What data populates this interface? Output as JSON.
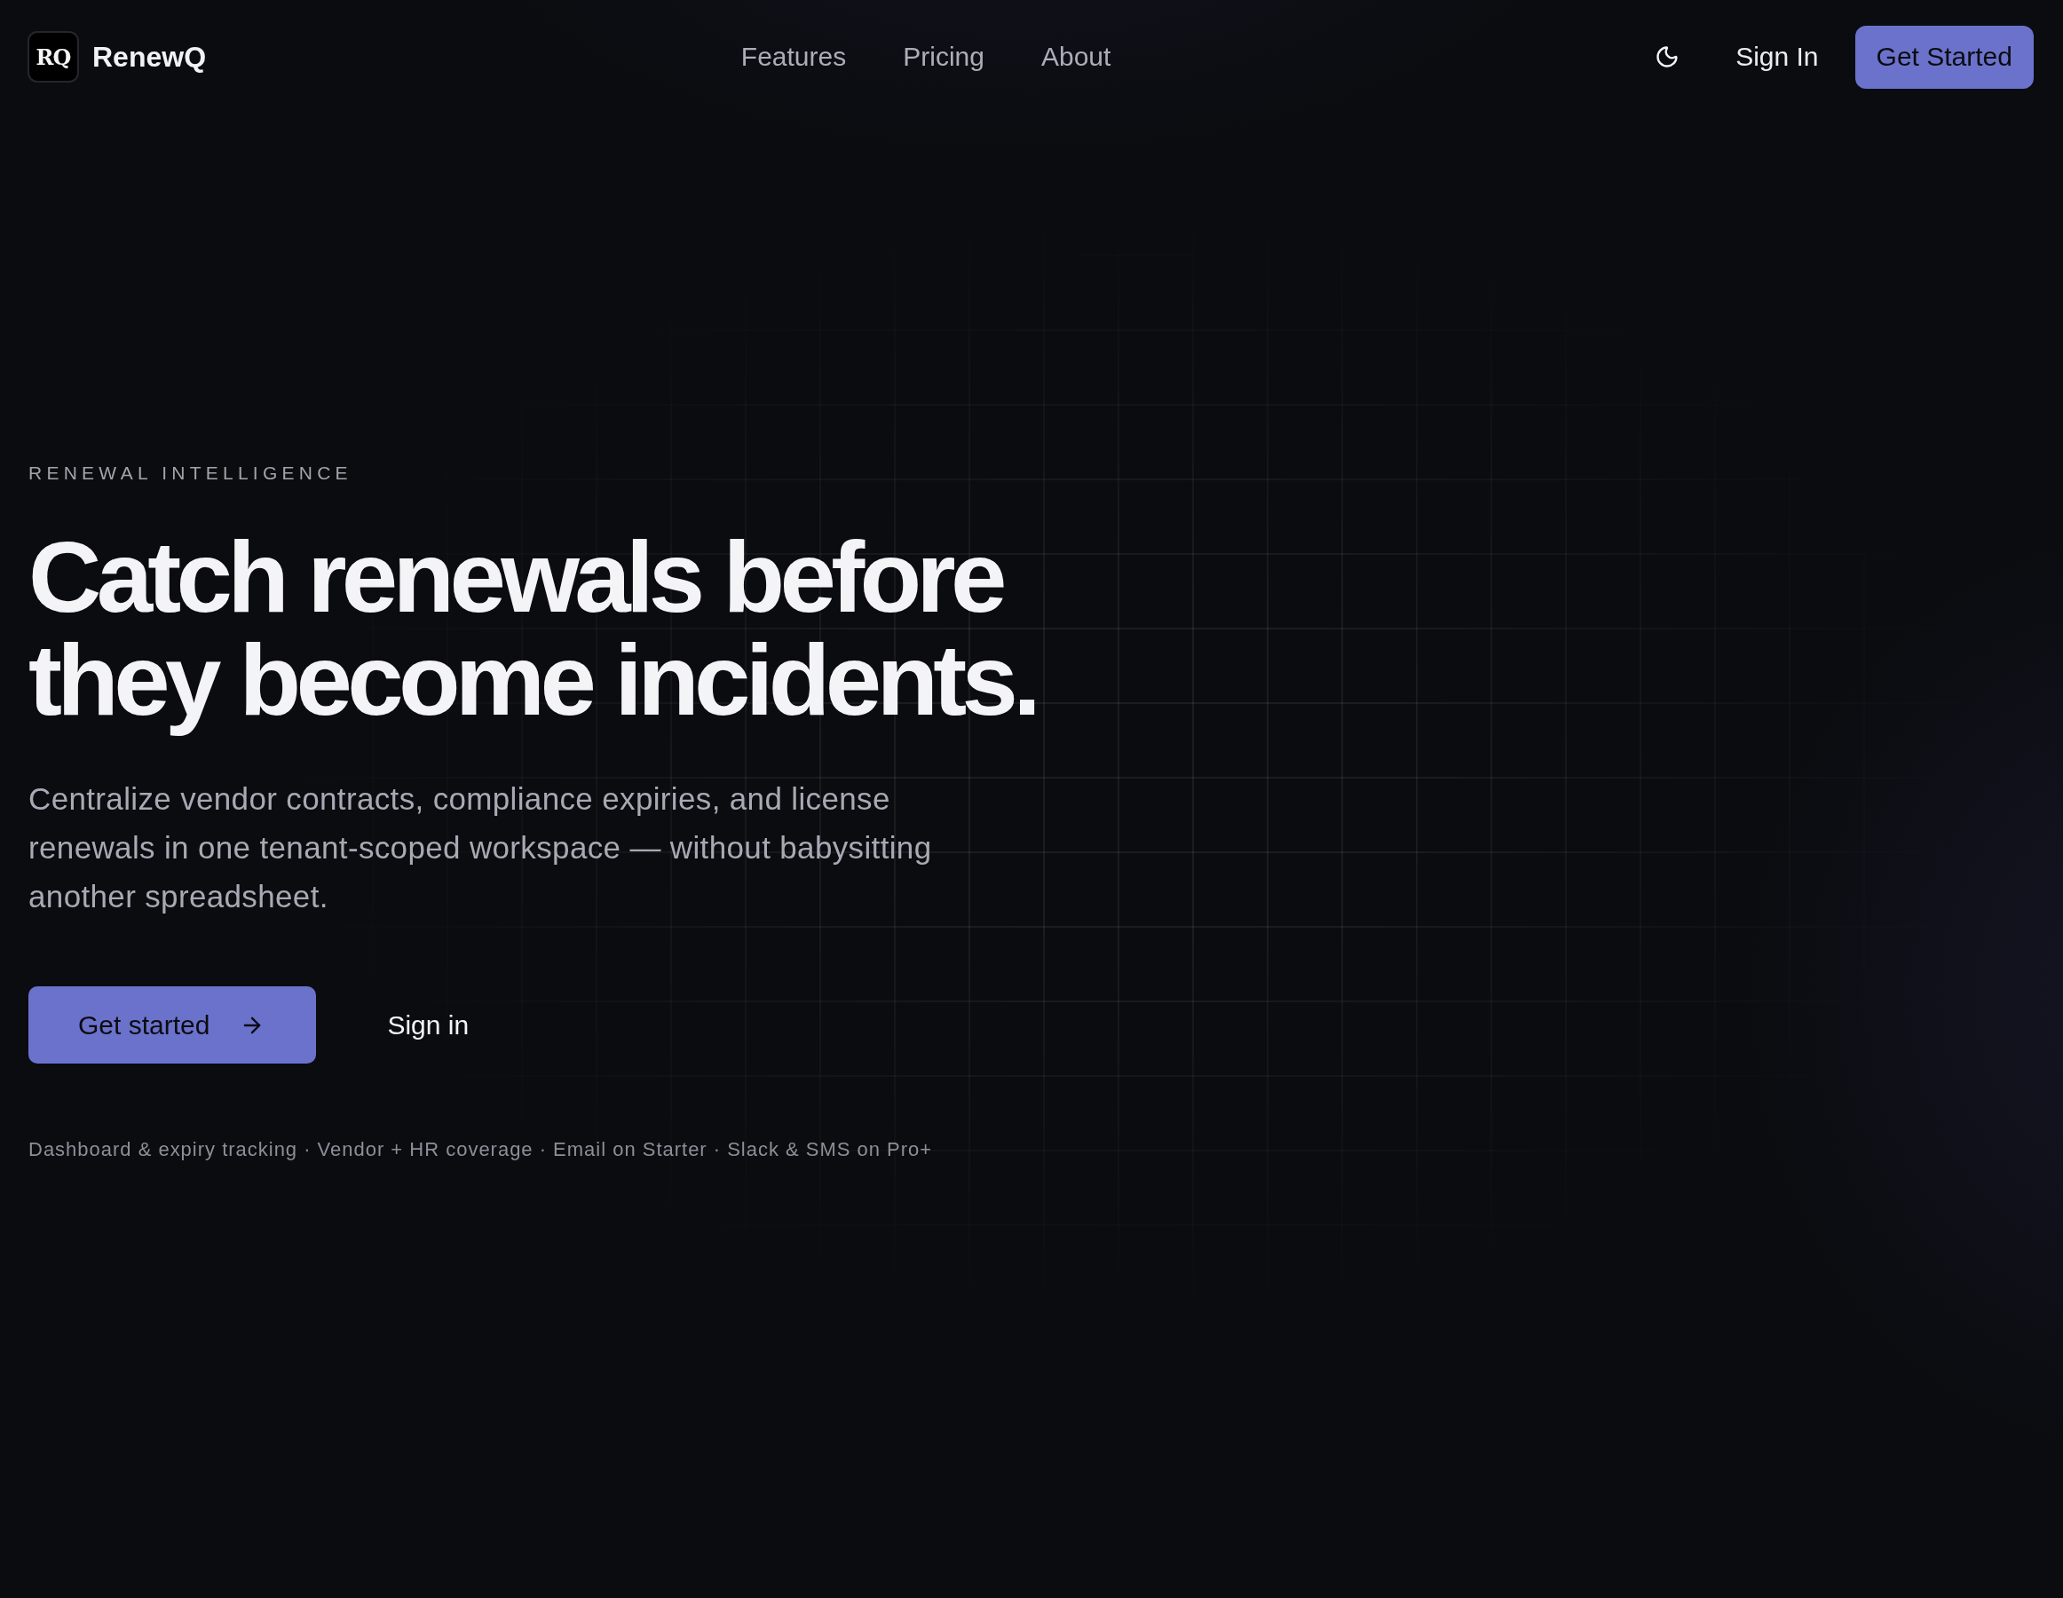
{
  "header": {
    "brand": {
      "monogram": "RQ",
      "name": "RenewQ"
    },
    "nav": [
      {
        "label": "Features"
      },
      {
        "label": "Pricing"
      },
      {
        "label": "About"
      }
    ],
    "sign_in": "Sign In",
    "cta": "Get Started"
  },
  "hero": {
    "eyebrow": "RENEWAL INTELLIGENCE",
    "headline": "Catch renewals before they become incidents.",
    "subtitle": "Centralize vendor contracts, compliance expiries, and license renewals in one tenant-scoped workspace — without babysitting another spreadsheet.",
    "buttons": [
      {
        "label": "Get started",
        "kind": "primary"
      },
      {
        "label": "Sign in",
        "kind": "ghost"
      }
    ],
    "highlights": "Dashboard & expiry tracking · Vendor + HR coverage · Email on Starter · Slack & SMS on Pro+"
  }
}
